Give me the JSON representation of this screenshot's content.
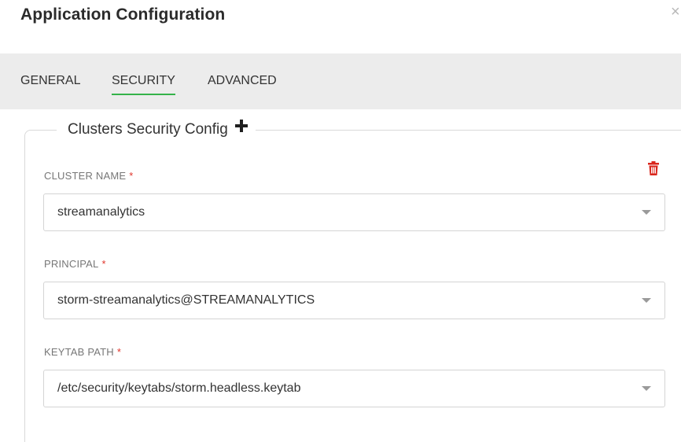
{
  "dialog": {
    "title": "Application Configuration",
    "close_glyph": "×"
  },
  "tabs": [
    {
      "label": "GENERAL",
      "active": false
    },
    {
      "label": "SECURITY",
      "active": true
    },
    {
      "label": "ADVANCED",
      "active": false
    }
  ],
  "section": {
    "legend": "Clusters Security Config",
    "add_icon": "plus-icon",
    "delete_icon": "trash-icon"
  },
  "fields": {
    "cluster_name": {
      "label": "CLUSTER NAME",
      "required_mark": "*",
      "value": "streamanalytics"
    },
    "principal": {
      "label": "PRINCIPAL",
      "required_mark": "*",
      "value": "storm-streamanalytics@STREAMANALYTICS"
    },
    "keytab_path": {
      "label": "KEYTAB PATH",
      "required_mark": "*",
      "value": "/etc/security/keytabs/storm.headless.keytab"
    }
  },
  "colors": {
    "accent": "#35b34a",
    "required": "#e0362c",
    "delete": "#d9261c",
    "tab_bar": "#ececec"
  }
}
